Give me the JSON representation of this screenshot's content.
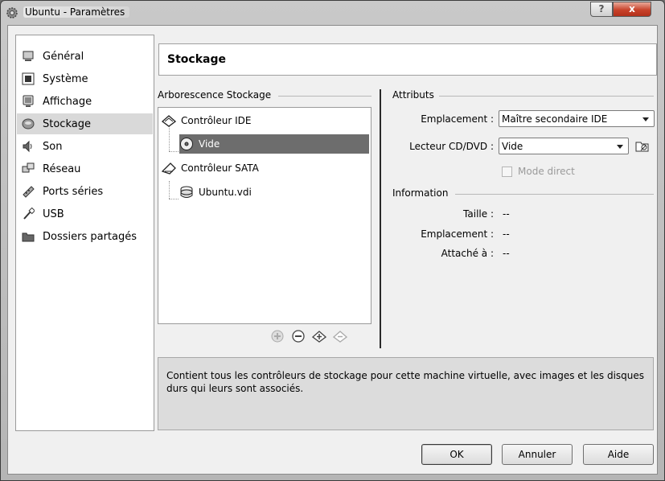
{
  "window": {
    "title": "Ubuntu - Paramètres",
    "help_label": "?",
    "close_label": "x"
  },
  "sidebar": {
    "items": [
      {
        "label": "Général",
        "icon": "monitor-icon"
      },
      {
        "label": "Système",
        "icon": "chip-icon"
      },
      {
        "label": "Affichage",
        "icon": "display-icon"
      },
      {
        "label": "Stockage",
        "icon": "disk-icon",
        "selected": true
      },
      {
        "label": "Son",
        "icon": "speaker-icon"
      },
      {
        "label": "Réseau",
        "icon": "network-icon"
      },
      {
        "label": "Ports séries",
        "icon": "serial-port-icon"
      },
      {
        "label": "USB",
        "icon": "usb-icon"
      },
      {
        "label": "Dossiers partagés",
        "icon": "folder-icon"
      }
    ]
  },
  "header": {
    "title": "Stockage"
  },
  "storage_tree": {
    "group_title": "Arborescence Stockage",
    "nodes": [
      {
        "label": "Contrôleur IDE",
        "icon": "ide-controller-icon"
      },
      {
        "label": "Vide",
        "icon": "cd-icon",
        "selected": true
      },
      {
        "label": "Contrôleur SATA",
        "icon": "sata-controller-icon"
      },
      {
        "label": "Ubuntu.vdi",
        "icon": "hard-disk-icon"
      }
    ]
  },
  "attributes": {
    "group_title": "Attributs",
    "location_label": "Emplacement :",
    "location_value": "Maître secondaire IDE",
    "cd_label": "Lecteur CD/DVD :",
    "cd_value": "Vide",
    "direct_mode_label": "Mode direct",
    "direct_mode_checked": false
  },
  "information": {
    "group_title": "Information",
    "size_label": "Taille :",
    "size_value": "--",
    "location_label": "Emplacement :",
    "location_value": "--",
    "attached_label": "Attaché à :",
    "attached_value": "--"
  },
  "description": "Contient tous les contrôleurs de stockage pour cette machine virtuelle, avec images et les disques durs qui leurs sont associés.",
  "buttons": {
    "ok": "OK",
    "cancel": "Annuler",
    "help": "Aide"
  },
  "colors": {
    "selection_sidebar": "#d9d9d9",
    "selection_tree": "#6d6d6d",
    "close_button": "#c8432b"
  }
}
